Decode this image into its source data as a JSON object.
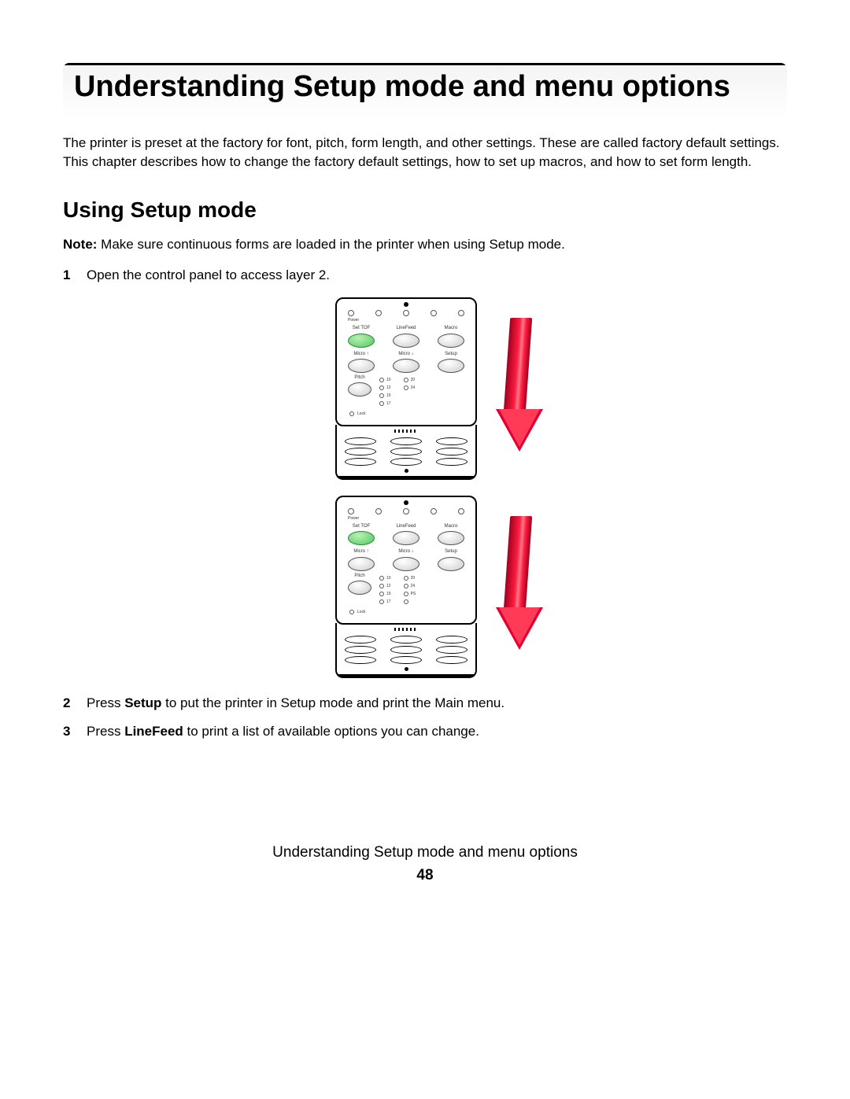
{
  "title": "Understanding Setup mode and menu options",
  "intro": "The printer is preset at the factory for font, pitch, form length, and other settings. These are called factory default settings. This chapter describes how to change the factory default settings, how to set up macros, and how to set form length.",
  "h2": "Using Setup mode",
  "note_prefix": "Note:",
  "note_body": " Make sure continuous forms are loaded in the printer when using Setup mode.",
  "steps": {
    "s1": "Open the control panel to access layer 2.",
    "s2_a": "Press ",
    "s2_b": "Setup",
    "s2_c": " to put the printer in Setup mode and print the Main menu.",
    "s3_a": "Press ",
    "s3_b": "LineFeed",
    "s3_c": " to print a list of available options you can change."
  },
  "panel": {
    "power": "Power",
    "row1": {
      "a": "Set TOF",
      "b": "LineFeed",
      "c": "Macro"
    },
    "row2": {
      "a": "Micro ↑",
      "b": "Micro ↓",
      "c": "Setup"
    },
    "pitch": "Pitch",
    "lock": "Lock",
    "pitch_vals": {
      "p10": "10",
      "p12": "12",
      "p15": "15",
      "p17": "17",
      "p20": "20",
      "p24": "24",
      "pPS": "PS"
    }
  },
  "footer": {
    "title": "Understanding Setup mode and menu options",
    "page": "48"
  }
}
